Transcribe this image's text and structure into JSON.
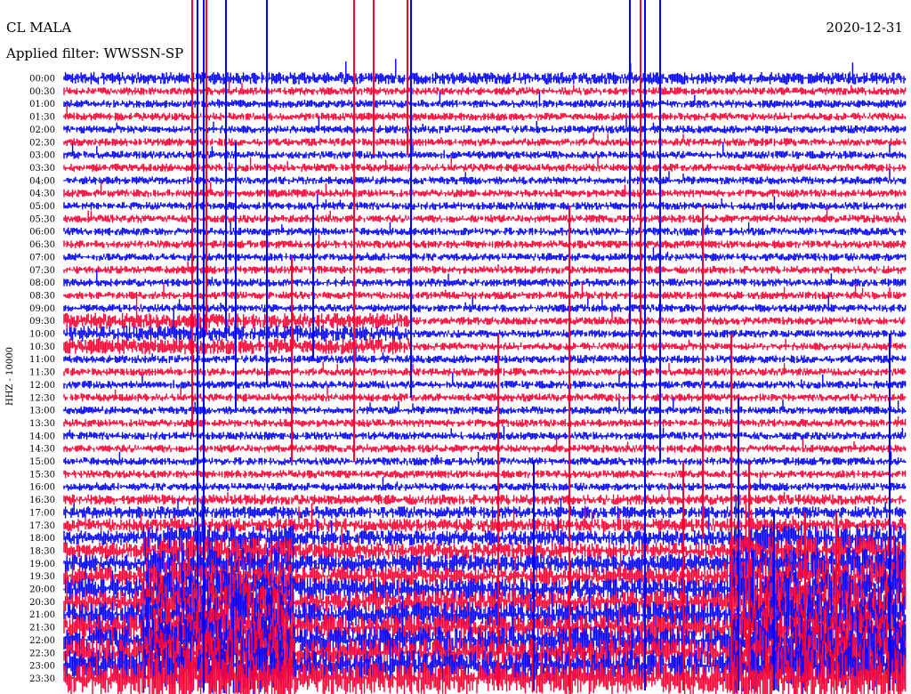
{
  "header": {
    "station": "CL MALA",
    "date": "2020-12-31",
    "filter": "Applied filter: WWSSN-SP"
  },
  "chart_data": {
    "type": "line",
    "title": "CL MALA",
    "ylabel": "HHZ - 10000",
    "row_labels": [
      "00:00",
      "00:30",
      "01:00",
      "01:30",
      "02:00",
      "02:30",
      "03:00",
      "03:30",
      "04:00",
      "04:30",
      "05:00",
      "05:30",
      "06:00",
      "06:30",
      "07:00",
      "07:30",
      "08:00",
      "08:30",
      "09:00",
      "09:30",
      "10:00",
      "10:30",
      "11:00",
      "11:30",
      "12:00",
      "12:30",
      "13:00",
      "13:30",
      "14:00",
      "14:30",
      "15:00",
      "15:30",
      "16:00",
      "16:30",
      "17:00",
      "17:30",
      "18:00",
      "18:30",
      "19:00",
      "19:30",
      "20:00",
      "20:30",
      "21:00",
      "21:30",
      "22:00",
      "22:30",
      "23:00",
      "23:30"
    ],
    "series_colors": [
      "#0000ff",
      "#ff0033"
    ],
    "grid": false
  }
}
